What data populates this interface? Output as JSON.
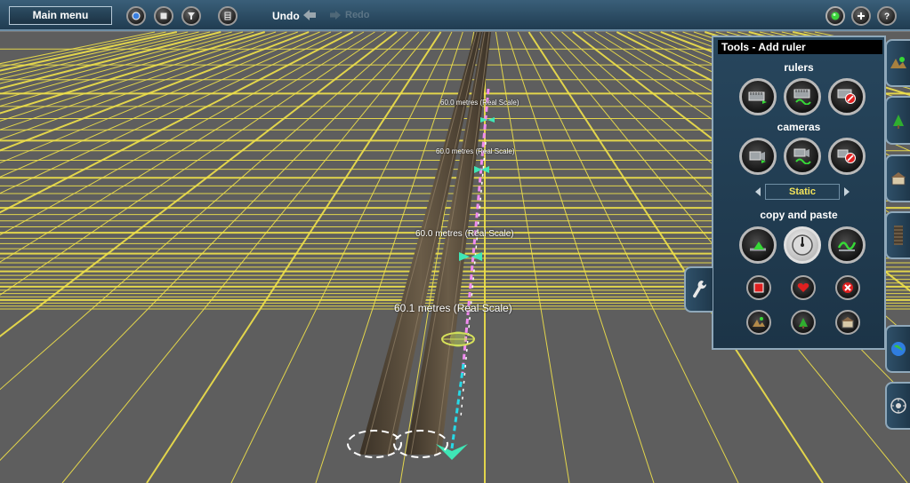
{
  "toolbar": {
    "main_menu": "Main menu",
    "undo": "Undo",
    "redo": "Redo"
  },
  "panel": {
    "title": "Tools - Add ruler",
    "rulers_label": "rulers",
    "cameras_label": "cameras",
    "camera_mode": "Static",
    "copy_paste_label": "copy and paste"
  },
  "ruler_labels": [
    "60.0 metres (Real Scale)",
    "60.0 metres (Real Scale)",
    "60.0 metres (Real Scale)",
    "60.1 metres (Real Scale)"
  ],
  "colors": {
    "toolbar_bg": "#2a4a61",
    "panel_bg": "#223d52",
    "grid_line": "#f1e24a",
    "ground": "#5e5e5e",
    "ruler_cyan": "#27d8e6",
    "ruler_pink": "#f08cf0",
    "accent_yellow": "#f3e35a"
  }
}
